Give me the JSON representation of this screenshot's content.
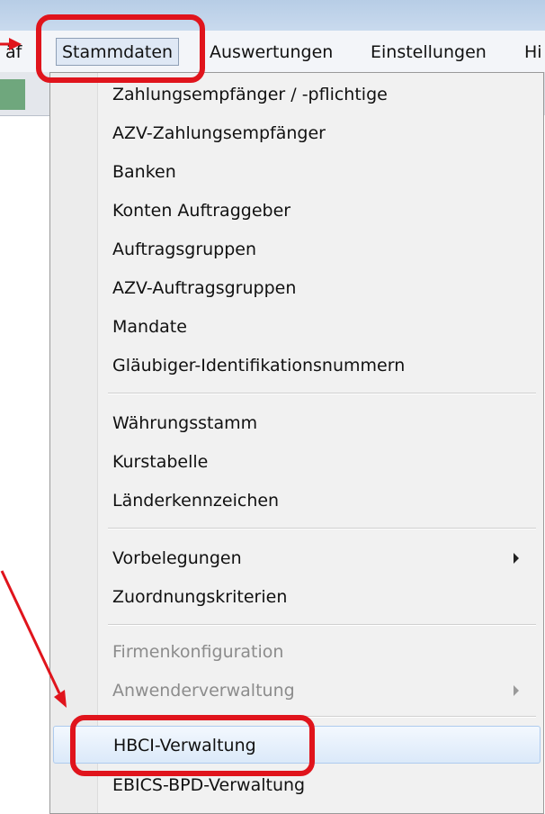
{
  "menubar": {
    "items": [
      {
        "label": "äf"
      },
      {
        "label": "Stammdaten"
      },
      {
        "label": "Auswertungen"
      },
      {
        "label": "Einstellungen"
      },
      {
        "label": "Hi"
      }
    ]
  },
  "menu": {
    "items": [
      {
        "label": "Zahlungsempfänger / -pflichtige"
      },
      {
        "label": "AZV-Zahlungsempfänger"
      },
      {
        "label": "Banken"
      },
      {
        "label": "Konten Auftraggeber"
      },
      {
        "label": "Auftragsgruppen"
      },
      {
        "label": "AZV-Auftragsgruppen"
      },
      {
        "label": "Mandate"
      },
      {
        "label": "Gläubiger-Identifikationsnummern"
      },
      {
        "label": "Währungsstamm"
      },
      {
        "label": "Kurstabelle"
      },
      {
        "label": "Länderkennzeichen"
      },
      {
        "label": "Vorbelegungen",
        "submenu": true
      },
      {
        "label": "Zuordnungskriterien"
      },
      {
        "label": "Firmenkonfiguration",
        "disabled": true
      },
      {
        "label": "Anwenderverwaltung",
        "disabled": true,
        "submenu": true
      },
      {
        "label": "HBCI-Verwaltung",
        "highlighted": true
      },
      {
        "label": "EBICS-BPD-Verwaltung"
      }
    ]
  },
  "annotation": {
    "color": "#e0141c"
  }
}
